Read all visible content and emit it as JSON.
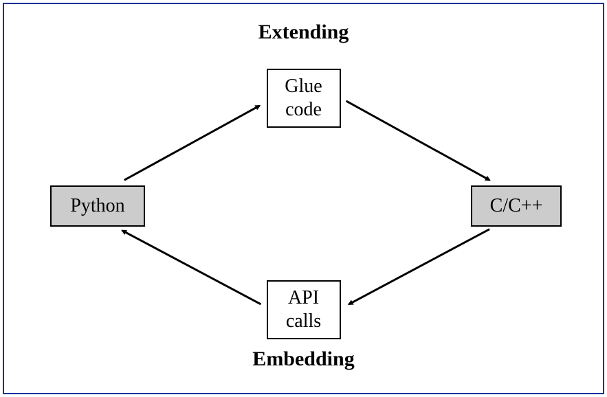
{
  "labels": {
    "top": "Extending",
    "bottom": "Embedding"
  },
  "nodes": {
    "left": "Python",
    "right": "C/C++",
    "topMiddle": "Glue\ncode",
    "bottomMiddle": "API\ncalls"
  }
}
